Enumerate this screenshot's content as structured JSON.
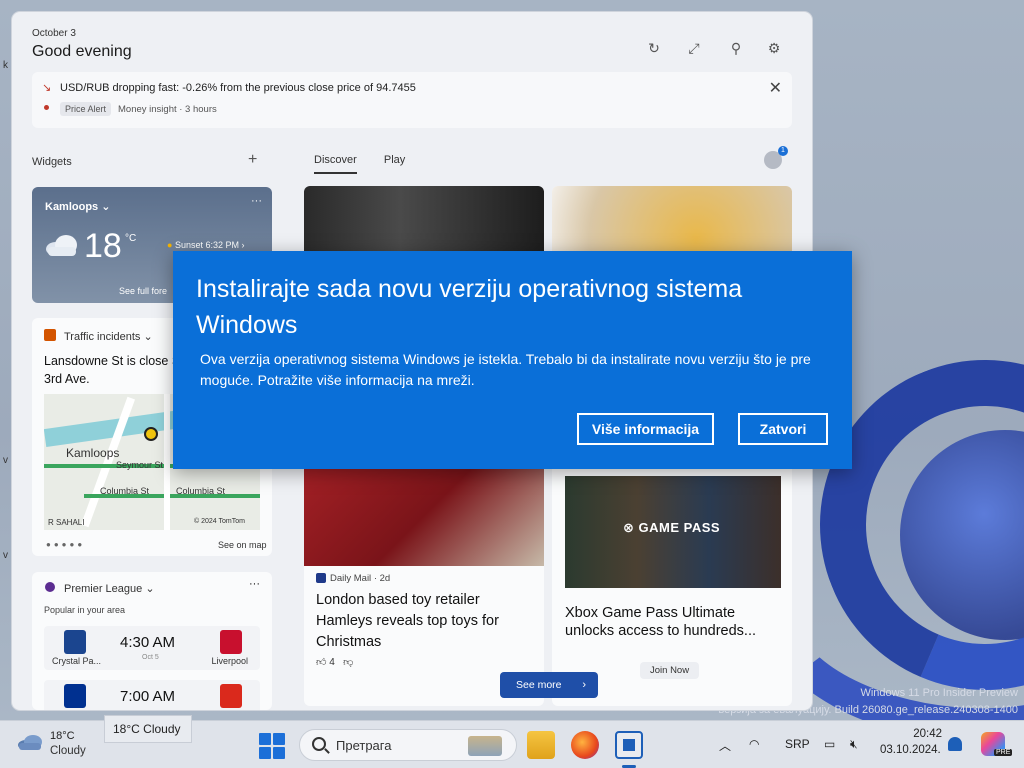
{
  "panel": {
    "date": "October 3",
    "greeting": "Good evening",
    "alert": {
      "title": "USD/RUB dropping fast: -0.26% from the previous close price of 94.7455",
      "badge": "Price Alert",
      "source": "Money insight · 3 hours"
    },
    "widgets_label": "Widgets",
    "tabs": [
      "Discover",
      "Play"
    ],
    "avatar_badge": "1",
    "weather": {
      "city": "Kamloops",
      "temp": "18",
      "unit": "°C",
      "sunset": "Sunset 6:32 PM",
      "forecast_link": "See full fore"
    },
    "traffic": {
      "title": "Traffic incidents",
      "text": "Lansdowne St is close St (East) to 3rd Ave.",
      "map_labels": [
        "Kamloops",
        "Seymour St",
        "Columbia St",
        "Columbia St",
        "R SAHALI",
        "© 2024 TomTom"
      ],
      "see_on_map": "See on map"
    },
    "league": {
      "title": "Premier League",
      "popular": "Popular in your area",
      "matches": [
        {
          "time": "4:30 AM",
          "sub": "Oct 5",
          "home": "Crystal Pa...",
          "away": "Liverpool",
          "home_color": "#1b458f",
          "away_color": "#c8102e"
        },
        {
          "time": "7:00 AM",
          "sub": "",
          "home": "",
          "away": "",
          "home_color": "#003090",
          "away_color": "#da291c"
        }
      ]
    },
    "news1": {
      "source": "Daily Mail",
      "age": "· 2d",
      "title": "London based toy retailer Hamleys reveals top toys for Christmas",
      "likes": "4"
    },
    "news2": {
      "gamepass_logo": "GAME PASS",
      "title": "Xbox Game Pass Ultimate unlocks access to hundreds...",
      "join": "Join Now"
    },
    "see_more": "See more"
  },
  "dialog": {
    "title": "Instalirajte sada novu verziju operativnog sistema Windows",
    "body": "Ova verzija operativnog sistema Windows je istekla. Trebalo bi da instalirate novu verziju što je pre moguće. Potražite više informacija na mreži.",
    "more_info": "Više informacija",
    "close": "Zatvori"
  },
  "watermark": {
    "line1": "Windows 11 Pro Insider Preview",
    "line2": "верзија за евалуацију. Build 26080.ge_release.240308-1400"
  },
  "taskbar": {
    "weather_temp": "18°C",
    "weather_cond": "Cloudy",
    "tooltip": "18°C Cloudy",
    "search_placeholder": "Претрага",
    "lang": "SRP",
    "time": "20:42",
    "date": "03.10.2024.",
    "copilot_tag": "PRE"
  },
  "colors": {
    "dialog_bg": "#0a6fd8",
    "accent": "#1d5fb8"
  }
}
